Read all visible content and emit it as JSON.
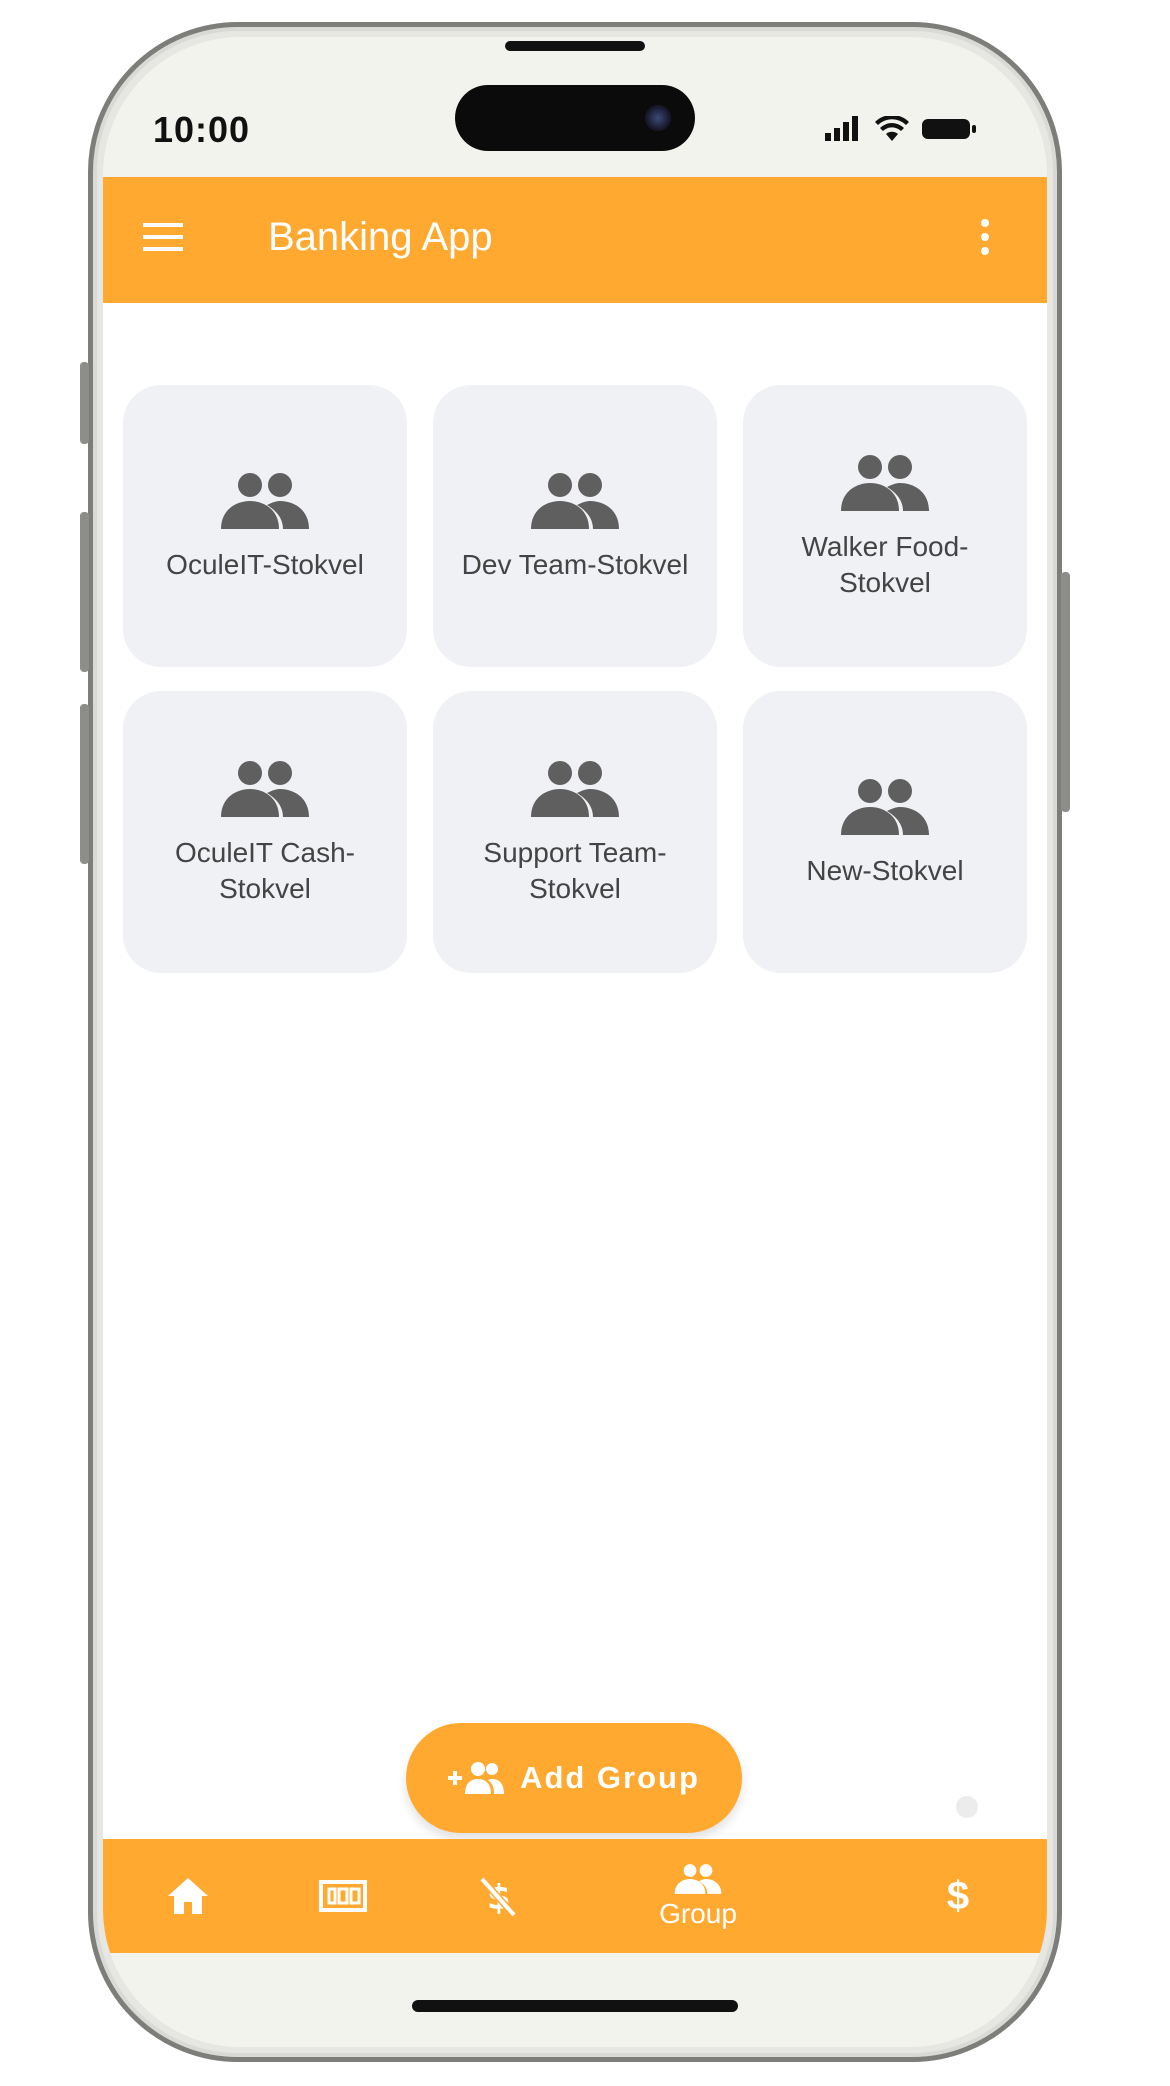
{
  "status_bar": {
    "time": "10:00"
  },
  "app_bar": {
    "title": "Banking App"
  },
  "groups": [
    {
      "label": "OculeIT-Stokvel"
    },
    {
      "label": "Dev Team-Stokvel"
    },
    {
      "label": "Walker Food-\nStokvel"
    },
    {
      "label": "OculeIT Cash-\nStokvel"
    },
    {
      "label": "Support Team-\nStokvel"
    },
    {
      "label": "New-Stokvel"
    }
  ],
  "fab": {
    "label": "Add Group",
    "icon": "group-add-icon"
  },
  "bottom_nav": {
    "items": [
      {
        "icon": "home-icon"
      },
      {
        "icon": "money-icon"
      },
      {
        "icon": "money-off-icon"
      },
      {
        "icon": "group-icon",
        "label": "Group"
      },
      {
        "icon": "dollar-icon",
        "label": "$"
      }
    ]
  },
  "colors": {
    "accent": "#ffa931",
    "card_bg": "#f0f1f5",
    "icon_gray": "#5f5f5f"
  }
}
